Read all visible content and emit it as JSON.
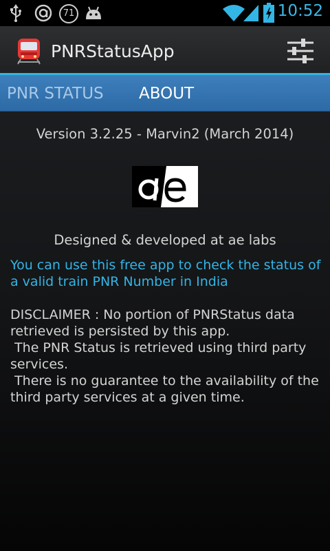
{
  "status_bar": {
    "time": "10:52",
    "notification_badge": "71",
    "icons": [
      "usb-icon",
      "app-notification-icon",
      "badge-count-icon",
      "android-icon",
      "wifi-icon",
      "signal-icon",
      "battery-charging-icon"
    ],
    "accent_color": "#33b5e5"
  },
  "action_bar": {
    "title": "PNRStatusApp",
    "app_icon": "train-icon",
    "settings_icon": "settings-sliders-icon"
  },
  "tabs": [
    {
      "label": "PNR STATUS",
      "selected": false
    },
    {
      "label": "ABOUT",
      "selected": true
    }
  ],
  "about": {
    "version": "Version 3.2.25 - Marvin2 (March 2014)",
    "logo_text": "ae",
    "designed_by": "Designed & developed at ae labs",
    "description": "You can use this free app to check the status of a valid train PNR Number in India",
    "disclaimer": "DISCLAIMER : No portion of PNRStatus data retrieved is persisted by this app.\n The PNR Status is retrieved using third party services.\n There is no guarantee to the availability of the third party services at a given time."
  }
}
